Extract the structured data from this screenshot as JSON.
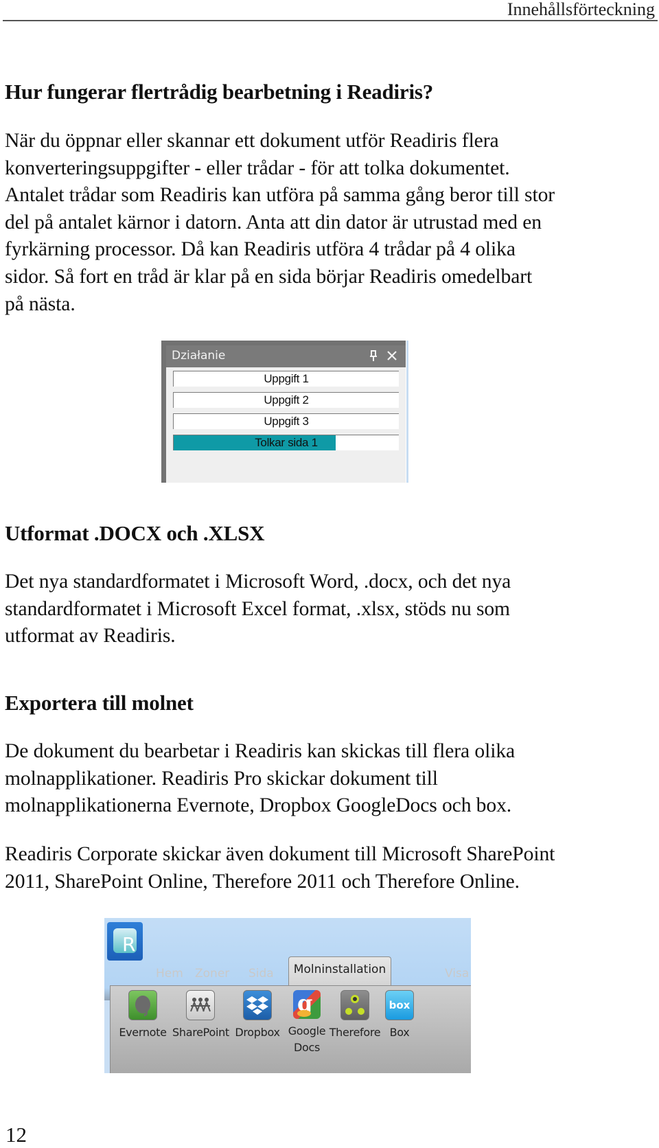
{
  "header": {
    "running_title": "Innehållsförteckning"
  },
  "sections": [
    {
      "heading": "Hur fungerar flertrådig bearbetning i Readiris?",
      "paragraphs": [
        "När du öppnar eller skannar ett dokument utför Readiris flera\nkonverteringsuppgifter - eller trådar - för att tolka dokumentet.\nAntalet trådar som Readiris kan utföra på samma gång beror till stor\ndel på antalet kärnor i datorn. Anta att din dator är utrustad med en\nfyrkärning processor. Då kan Readiris utföra 4 trådar på 4 olika\nsidor. Så fort en tråd är klar på en sida börjar Readiris omedelbart\npå nästa."
      ]
    },
    {
      "heading": "Utformat .DOCX och .XLSX",
      "paragraphs": [
        "Det nya standardformatet i Microsoft Word, .docx, och det nya\nstandardformatet i Microsoft Excel format, .xlsx, stöds nu som\nutformat av Readiris."
      ]
    },
    {
      "heading": "Exportera till molnet",
      "paragraphs": [
        "De dokument du bearbetar i Readiris kan skickas till flera olika\nmolnapplikationer. Readiris Pro skickar dokument till\nmolnapplikationerna Evernote, Dropbox GoogleDocs och box.",
        "Readiris Corporate skickar även dokument till Microsoft SharePoint\n2011, SharePoint Online, Therefore 2011 och Therefore Online."
      ]
    }
  ],
  "activity_panel": {
    "title": "Działanie",
    "pin_icon": "pin-icon",
    "close_icon": "close-icon",
    "tasks": [
      {
        "label": "Uppgift 1",
        "progress": 0
      },
      {
        "label": "Uppgift 2",
        "progress": 0
      },
      {
        "label": "Uppgift 3",
        "progress": 0
      },
      {
        "label": "Tolkar sida 1",
        "progress": 0.72
      }
    ],
    "progress_color": "#0f9aa6"
  },
  "ribbon": {
    "app_logo_letter": "R",
    "tabs": [
      {
        "label": "Hem",
        "active": false
      },
      {
        "label": "Zoner",
        "active": false
      },
      {
        "label": "Sida",
        "active": false
      },
      {
        "label": "Molninstallation",
        "active": true
      },
      {
        "label": "Visa",
        "active": false
      }
    ],
    "buttons": [
      {
        "label": "Evernote",
        "icon": "evernote-icon"
      },
      {
        "label": "SharePoint",
        "icon": "sharepoint-icon"
      },
      {
        "label": "Dropbox",
        "icon": "dropbox-icon"
      },
      {
        "label": "Google\nDocs",
        "icon": "google-docs-icon"
      },
      {
        "label": "Therefore",
        "icon": "therefore-icon"
      },
      {
        "label": "Box",
        "icon": "box-icon",
        "glyph": "box"
      }
    ]
  },
  "footer": {
    "page_number": "12"
  }
}
